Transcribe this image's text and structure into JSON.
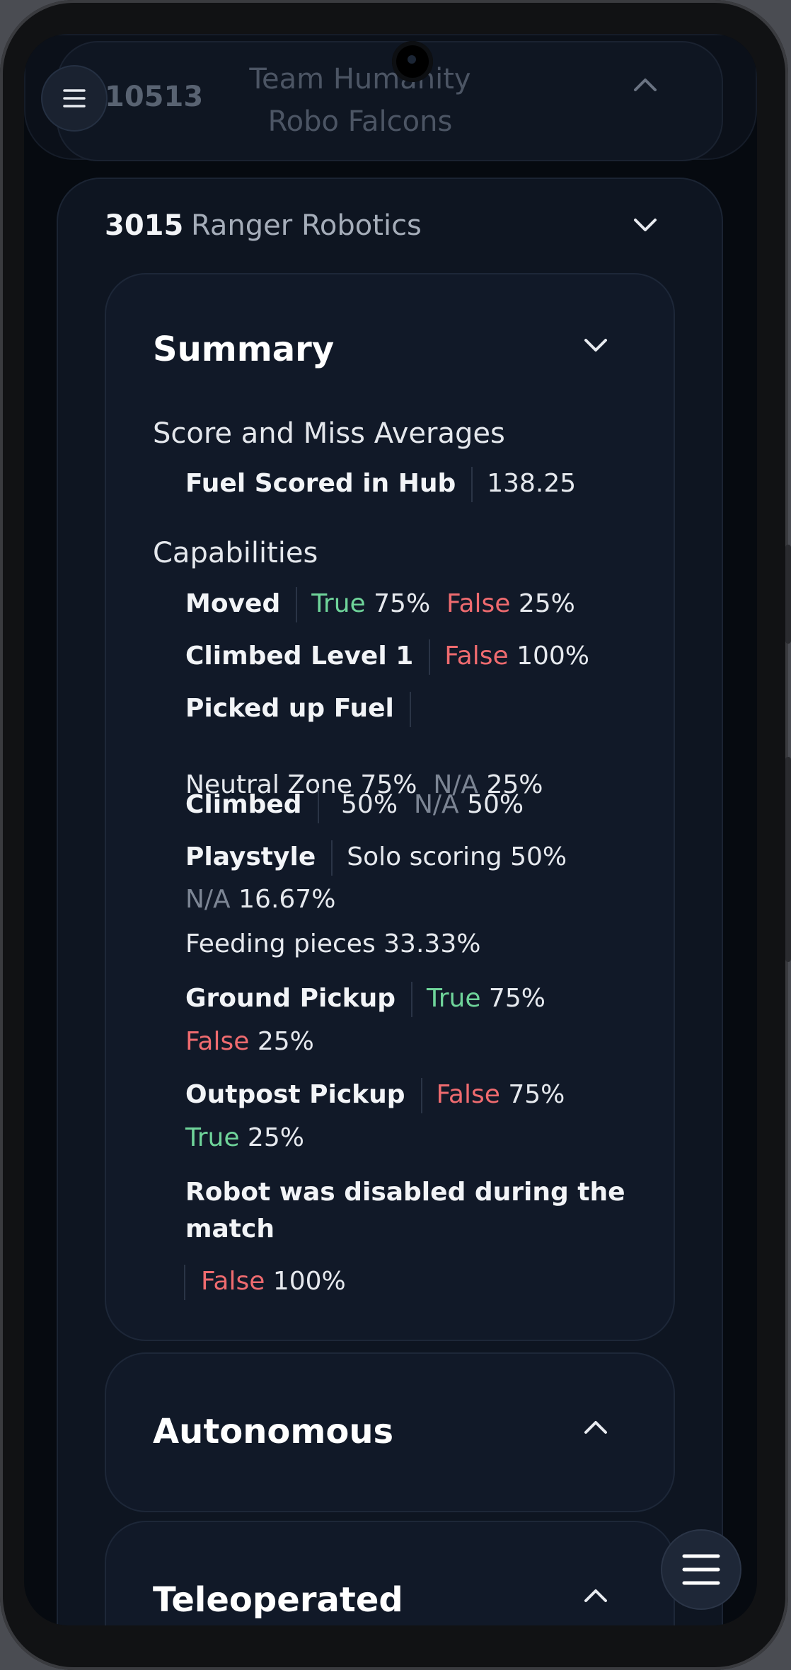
{
  "collapsed_team": {
    "number": "10513",
    "name": "Team Humanity Robo Falcons"
  },
  "team": {
    "number": "3015",
    "name": "Ranger Robotics"
  },
  "summary": {
    "title": "Summary",
    "score_heading": "Score and Miss Averages",
    "fuel_label": "Fuel Scored in Hub",
    "fuel_value": "138.25",
    "cap_heading": "Capabilities",
    "moved": {
      "label": "Moved",
      "true_label": "True",
      "true_pct": "75%",
      "false_label": "False",
      "false_pct": "25%"
    },
    "climbed_l1": {
      "label": "Climbed Level 1",
      "false_label": "False",
      "false_pct": "100%"
    },
    "picked_fuel": {
      "label": "Picked up Fuel",
      "opt1": "Neutral Zone",
      "opt1_pct": "75%",
      "na_label": "N/A",
      "na_pct": "25%"
    },
    "climbed": {
      "label": "Climbed",
      "blank_pct": "50%",
      "na_label": "N/A",
      "na_pct": "50%"
    },
    "playstyle": {
      "label": "Playstyle",
      "opt1": "Solo scoring",
      "opt1_pct": "50%",
      "na_label": "N/A",
      "na_pct": "16.67%",
      "opt2": "Feeding pieces",
      "opt2_pct": "33.33%"
    },
    "ground_pickup": {
      "label": "Ground Pickup",
      "true_label": "True",
      "true_pct": "75%",
      "false_label": "False",
      "false_pct": "25%"
    },
    "outpost_pickup": {
      "label": "Outpost Pickup",
      "false_label": "False",
      "false_pct": "75%",
      "true_label": "True",
      "true_pct": "25%"
    },
    "disabled": {
      "label_line1": "Robot was disabled during the",
      "label_line2": "match",
      "false_label": "False",
      "false_pct": "100%"
    }
  },
  "sections": {
    "autonomous": "Autonomous",
    "teleoperated": "Teleoperated"
  },
  "icons": {
    "menu": "menu-icon",
    "chevron_up": "chevron-up-icon",
    "chevron_down": "chevron-down-icon"
  },
  "colors": {
    "true": "#6fd49a",
    "false": "#ef6b6f",
    "na": "#7c8594",
    "background": "#060a10"
  }
}
